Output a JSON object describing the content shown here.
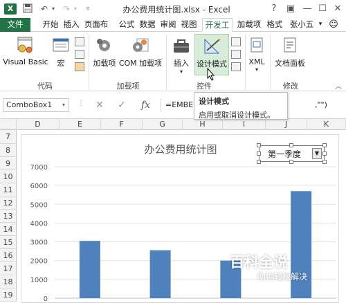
{
  "window": {
    "title": "办公费用统计图.xlsx - Excel",
    "controls": [
      "?",
      "▣",
      "—",
      "☐",
      "✕"
    ]
  },
  "tabs": [
    "文件",
    "开始",
    "插入",
    "页面布",
    "公式",
    "数据",
    "审阅",
    "视图",
    "开发工",
    "加载项",
    "格式",
    "张小五"
  ],
  "ribbon": {
    "groups": {
      "code": "代码",
      "addins": "加载项",
      "controls": "控件",
      "modify": "修改"
    },
    "buttons": {
      "visual_basic": "Visual Basic",
      "macros": "宏",
      "addins": "加载项",
      "com_addins": "COM 加载项",
      "insert": "插入",
      "design_mode": "设计模式",
      "xml": "XML",
      "document_panel": "文档面板"
    }
  },
  "formula_bar": {
    "name_box": "ComboBox1",
    "formula_start": "=EMBED",
    "formula_end": ",\"\")",
    "fx": "fx"
  },
  "tooltip": {
    "title": "设计模式",
    "description": "启用或取消设计模式。"
  },
  "columns": [
    "D",
    "E",
    "F",
    "G",
    "H",
    "I",
    "J",
    "K"
  ],
  "rows": [
    "7",
    "8",
    "9",
    "10",
    "11",
    "12",
    "13",
    "14",
    "15",
    "16",
    "17",
    "18",
    "19"
  ],
  "combo": {
    "value": "第一季度"
  },
  "chart_data": {
    "type": "bar",
    "title": "办公费用统计图",
    "categories": [
      "",
      "",
      "",
      ""
    ],
    "values": [
      3050,
      2550,
      2000,
      5700
    ],
    "ylim": [
      0,
      7000
    ],
    "yticks": [
      "0",
      "1000",
      "2000",
      "3000",
      "4000",
      "5000",
      "6000",
      "7000"
    ],
    "grid": true,
    "bar_color": "#4f81bd"
  },
  "watermark": {
    "main": "百科全说",
    "sub": "助你轻松解决"
  },
  "colors": {
    "accent": "#217346",
    "bar": "#4f81bd"
  }
}
